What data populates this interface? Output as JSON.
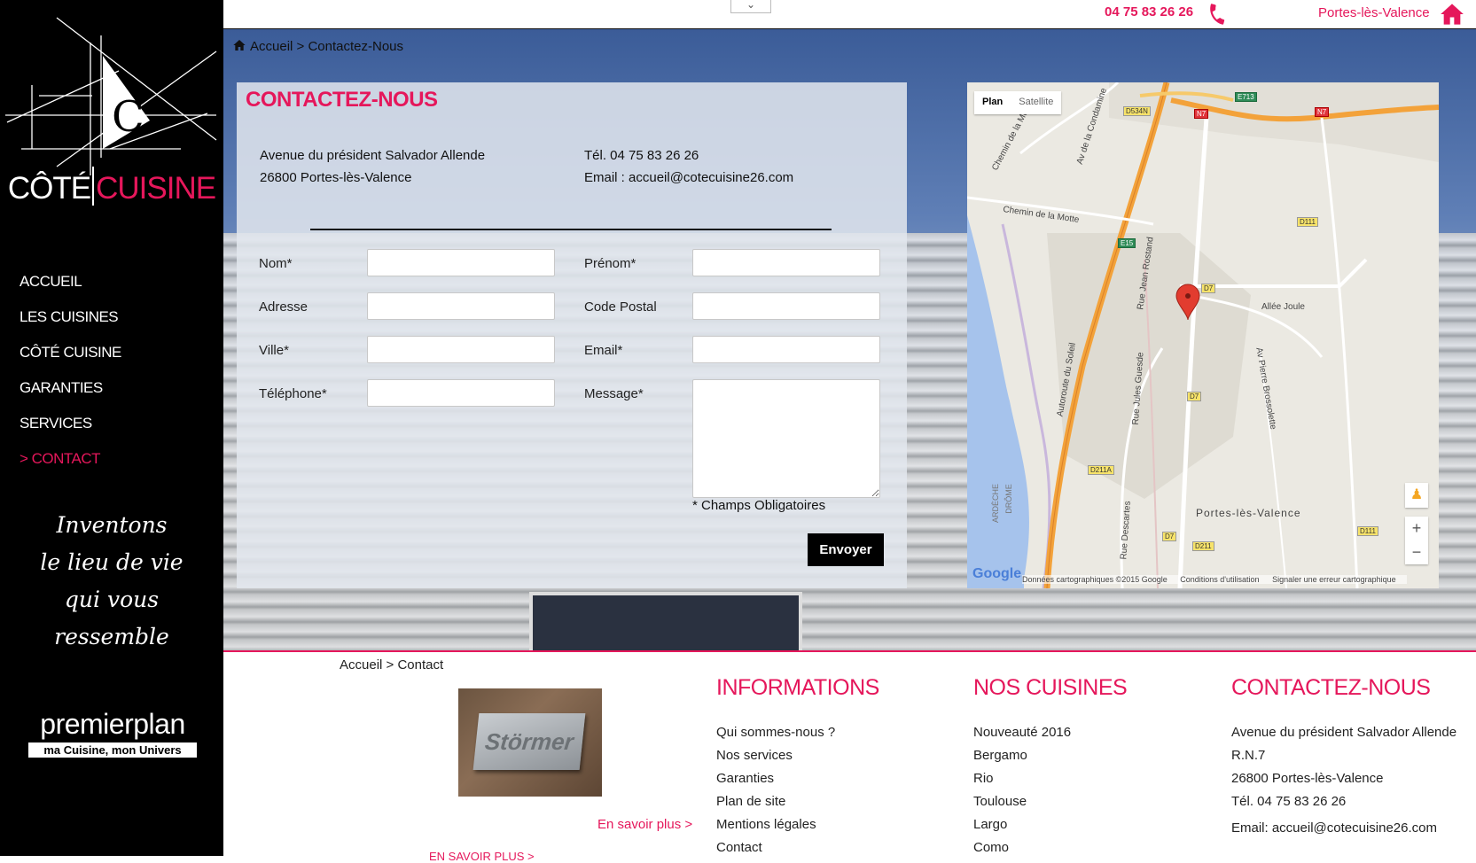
{
  "sidebar": {
    "logo": {
      "word1": "CÔTÉ",
      "word2": "CUISINE",
      "letter": "C"
    },
    "nav": [
      {
        "label": "ACCUEIL",
        "active": false
      },
      {
        "label": "LES CUISINES",
        "active": false
      },
      {
        "label": "CÔTÉ CUISINE",
        "active": false
      },
      {
        "label": "GARANTIES",
        "active": false
      },
      {
        "label": "SERVICES",
        "active": false
      },
      {
        "label": "> CONTACT",
        "active": true
      }
    ],
    "slogan": [
      "Inventons",
      "le lieu de vie",
      "qui vous",
      "ressemble"
    ],
    "partner": {
      "title_light": "premier",
      "title_bold": "plan",
      "subtitle": "ma Cuisine, mon Univers"
    }
  },
  "topbar": {
    "phone": "04 75 83 26 26",
    "city": "Portes-lès-Valence",
    "accent": "#e5175b"
  },
  "breadcrumb": {
    "home": "Accueil",
    "sep": " > ",
    "current": "Contactez-Nous"
  },
  "contact": {
    "title": "CONTACTEZ-NOUS",
    "address_line1": "Avenue du président Salvador Allende",
    "address_line2": "26800 Portes-lès-Valence",
    "tel": "Tél. 04 75 83 26 26",
    "email": "Email : accueil@cotecuisine26.com",
    "form": {
      "nom": "Nom*",
      "prenom": "Prénom*",
      "adresse": "Adresse",
      "code_postal": "Code Postal",
      "ville": "Ville*",
      "email": "Email*",
      "telephone": "Téléphone*",
      "message": "Message*",
      "required_note": "* Champs Obligatoires",
      "submit": "Envoyer"
    }
  },
  "map": {
    "type_plan": "Plan",
    "type_satellite": "Satellite",
    "zoom_in": "+",
    "zoom_out": "−",
    "logo": "Google",
    "footer": [
      "Données cartographiques ©2015 Google",
      "Conditions d'utilisation",
      "Signaler une erreur cartographique"
    ],
    "labels": {
      "chemin_motte1": "Chemin de la Motte",
      "chemin_motte2": "Chemin de la Motte",
      "av_condamine": "Av de la Condamine",
      "allee_joule": "Allée Joule",
      "portes": "Portes-lès-Valence",
      "autoroute": "Autoroute du Soleil",
      "jean_rostand": "Rue Jean Rostand",
      "jules_guesde": "Rue Jules Guesde",
      "pierre_brossolette": "Av Pierre Brossolette",
      "descartes": "Rue Descartes",
      "ardeche": "ARDÈCHE",
      "drome": "DRÔME"
    },
    "road_tags": {
      "d534n": "D534N",
      "n7a": "N7",
      "n7b": "N7",
      "e713": "E713",
      "e15": "E15",
      "d111a": "D111",
      "d111b": "D111",
      "d7a": "D7",
      "d7b": "D7",
      "d7c": "D7",
      "d211a": "D211A",
      "d211": "D211"
    }
  },
  "footer": {
    "breadcrumb": "Accueil > Contact",
    "image_text": "Störmer",
    "more": "En savoir plus >",
    "cut_text": "EN SAVOIR PLUS >",
    "informations": {
      "title": "INFORMATIONS",
      "links": [
        "Qui sommes-nous ?",
        "Nos services",
        "Garanties",
        "Plan de site",
        "Mentions légales",
        "Contact"
      ]
    },
    "cuisines": {
      "title": "NOS CUISINES",
      "links": [
        "Nouveauté 2016",
        "Bergamo",
        "Rio",
        "Toulouse",
        "Largo",
        "Como"
      ]
    },
    "contact": {
      "title": "CONTACTEZ-NOUS",
      "lines": [
        "Avenue du président Salvador Allende",
        "R.N.7",
        "26800 Portes-lès-Valence",
        "Tél. 04 75 83 26 26",
        "Email: accueil@cotecuisine26.com"
      ]
    }
  }
}
